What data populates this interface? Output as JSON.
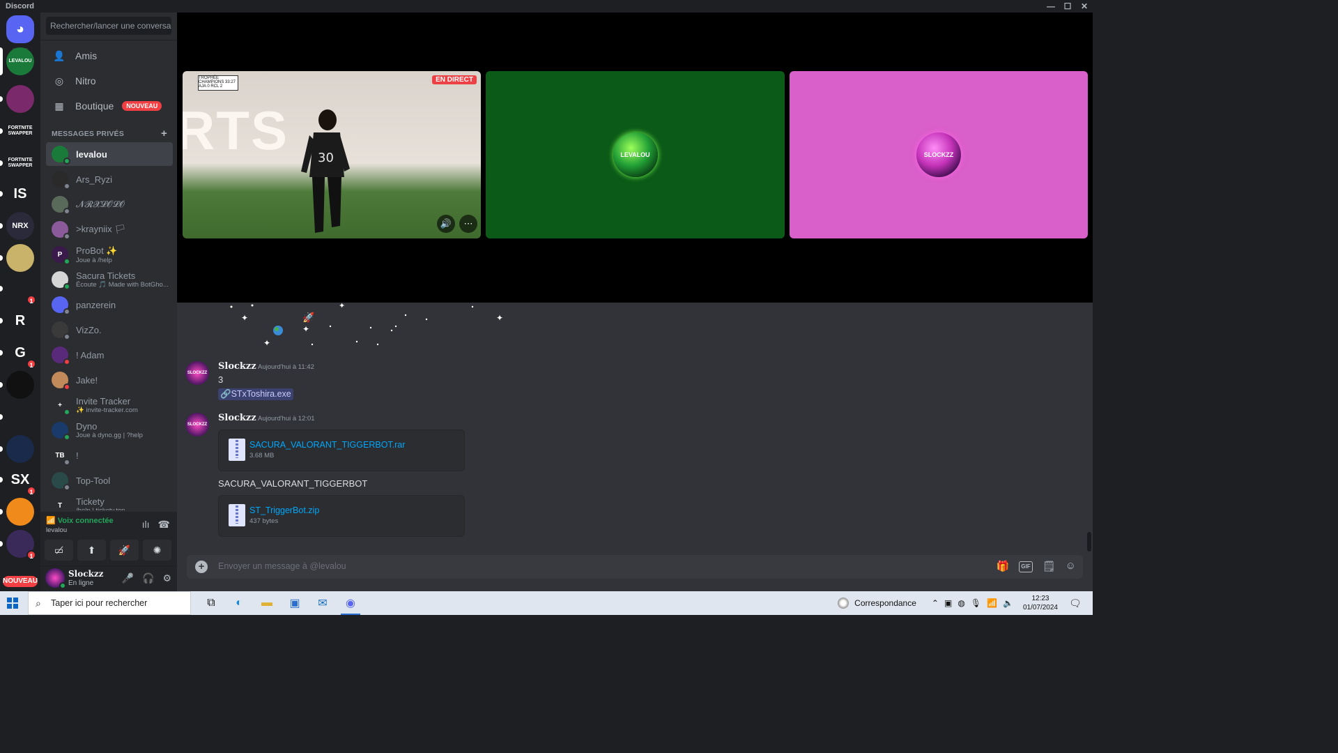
{
  "window": {
    "title": "Discord",
    "controls": [
      "—",
      "☐",
      "✕"
    ]
  },
  "rail": {
    "servers": [
      {
        "label": "",
        "color": "#5865f2",
        "badge": ""
      },
      {
        "label": "LEVALOU",
        "color": "#1a7a3a",
        "badge": ""
      },
      {
        "label": "",
        "color": "#7a2a6a",
        "badge": ""
      },
      {
        "label": "FORTNITE SWAPPER",
        "color": "#1e1f22",
        "badge": ""
      },
      {
        "label": "FORTNITE SWAPPER",
        "color": "#1e1f22",
        "badge": ""
      },
      {
        "label": "IS",
        "color": "#1e1f22",
        "badge": ""
      },
      {
        "label": "NRX",
        "color": "#2a2a3a",
        "badge": ""
      },
      {
        "label": "",
        "color": "#c9b26a",
        "badge": ""
      },
      {
        "label": "",
        "color": "#1e1f22",
        "badge": "1"
      },
      {
        "label": "R",
        "color": "#1e1f22",
        "badge": ""
      },
      {
        "label": "G",
        "color": "#1e1f22",
        "badge": "1"
      },
      {
        "label": "",
        "color": "#111111",
        "badge": ""
      },
      {
        "label": "",
        "color": "#1e1f22",
        "badge": ""
      },
      {
        "label": "",
        "color": "#1a2a4a",
        "badge": ""
      },
      {
        "label": "SX",
        "color": "#1e1f22",
        "badge": "1"
      },
      {
        "label": "",
        "color": "#f08a1a",
        "badge": ""
      },
      {
        "label": "",
        "color": "#3a2a5a",
        "badge": "1"
      }
    ],
    "nouveau": "NOUVEAU"
  },
  "sidebar": {
    "search_placeholder": "Rechercher/lancer une conversa...",
    "nav": [
      {
        "label": "Amis",
        "icon": "friends-icon"
      },
      {
        "label": "Nitro",
        "icon": "nitro-icon"
      },
      {
        "label": "Boutique",
        "icon": "shop-icon",
        "badge": "NOUVEAU"
      }
    ],
    "dm_header": "MESSAGES PRIVÉS",
    "dms": [
      {
        "name": "levalou",
        "sub": "",
        "status": "online",
        "color": "#1a7a3a",
        "initials": "",
        "active": true
      },
      {
        "name": "Ars_Ryzi",
        "sub": "",
        "status": "offline",
        "color": "#2a2a2a",
        "initials": ""
      },
      {
        "name": "𝓝𝓡𝓧𝓛𝓞𝓛𝓞",
        "sub": "",
        "status": "offline",
        "color": "#5a6a5a",
        "initials": ""
      },
      {
        "name": ">krayniix 🏳",
        "sub": "",
        "status": "offline",
        "color": "#8a5a9a",
        "initials": ""
      },
      {
        "name": "ProBot ✨",
        "sub": "Joue à /help",
        "status": "online",
        "color": "#3a1a4a",
        "initials": "P"
      },
      {
        "name": "Sacura Tickets",
        "sub": "Écoute 🎵 Made with BotGho...",
        "status": "online",
        "color": "#d6d6d6",
        "initials": ""
      },
      {
        "name": "panzerein",
        "sub": "",
        "status": "offline",
        "color": "#5865f2",
        "initials": ""
      },
      {
        "name": "VizZo.",
        "sub": "",
        "status": "offline",
        "color": "#3a3a3a",
        "initials": ""
      },
      {
        "name": "! Adam",
        "sub": "",
        "status": "dnd",
        "color": "#5a2a7a",
        "initials": ""
      },
      {
        "name": "Jake!",
        "sub": "",
        "status": "dnd",
        "color": "#c08a5a",
        "initials": ""
      },
      {
        "name": "Invite Tracker",
        "sub": "✨ invite-tracker.com",
        "status": "online",
        "color": "#2b2d31",
        "initials": "+"
      },
      {
        "name": "Dyno",
        "sub": "Joue à dyno.gg | ?help",
        "status": "online",
        "color": "#1a3a6a",
        "initials": ""
      },
      {
        "name": "!",
        "sub": "",
        "status": "offline",
        "color": "#2b2d31",
        "initials": "TB"
      },
      {
        "name": "Top-Tool",
        "sub": "",
        "status": "offline",
        "color": "#2a4a4a",
        "initials": ""
      },
      {
        "name": "Tickety",
        "sub": "/help | tickety.top",
        "status": "online",
        "color": "#2b2d31",
        "initials": "T"
      }
    ],
    "voice": {
      "connected_label": "Voix connectée",
      "channel": "levalou"
    },
    "user": {
      "name": "Slockzz",
      "status": "En ligne"
    }
  },
  "stage": {
    "live_badge": "EN DIRECT",
    "video_text": "RTS",
    "scoreboard": "TROPHÉE CHAMPIONS 33:27 AJA 0 RCL 2",
    "tiles": [
      {
        "label": "LEVALOU"
      },
      {
        "label": "SLOCKZZ"
      }
    ]
  },
  "messages": [
    {
      "author": "Slockzz",
      "time": "Aujourd'hui à 11:42",
      "avatar_text": "SLOCKZZ",
      "body": "3",
      "link": "STxToshira.exe"
    },
    {
      "author": "Slockzz",
      "time": "Aujourd'hui à 12:01",
      "avatar_text": "SLOCKZZ",
      "file1": {
        "name": "SACURA_VALORANT_TIGGERBOT.rar",
        "size": "3.68 MB"
      },
      "text": "SACURA_VALORANT_TIGGERBOT",
      "file2": {
        "name": "ST_TriggerBot.zip",
        "size": "437 bytes"
      }
    }
  ],
  "composer": {
    "placeholder": "Envoyer un message à @levalou",
    "gif_label": "GIF"
  },
  "taskbar": {
    "search_placeholder": "Taper ici pour rechercher",
    "weather": "Correspondance",
    "time": "12:23",
    "date": "01/07/2024"
  }
}
